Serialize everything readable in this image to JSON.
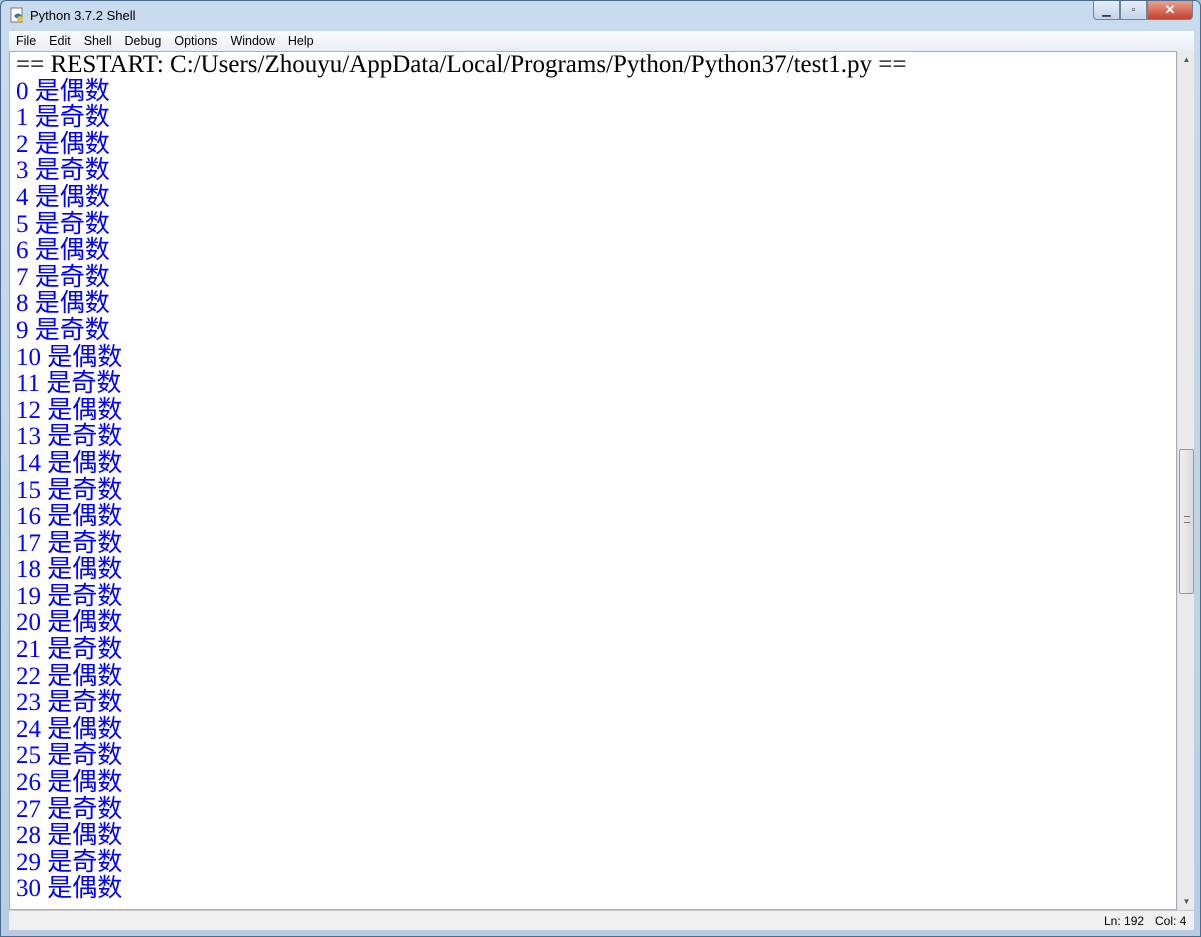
{
  "window": {
    "title": "Python 3.7.2 Shell",
    "icon": "python-idle-icon",
    "controls": [
      "minimize",
      "maximize",
      "close"
    ]
  },
  "menu": [
    "File",
    "Edit",
    "Shell",
    "Debug",
    "Options",
    "Window",
    "Help"
  ],
  "shell": {
    "restart_line": "== RESTART: C:/Users/Zhouyu/AppData/Local/Programs/Python/Python37/test1.py ==",
    "output_color": "#0000ff",
    "output": [
      "0 是偶数",
      "1 是奇数",
      "2 是偶数",
      "3 是奇数",
      "4 是偶数",
      "5 是奇数",
      "6 是偶数",
      "7 是奇数",
      "8 是偶数",
      "9 是奇数",
      "10 是偶数",
      "11 是奇数",
      "12 是偶数",
      "13 是奇数",
      "14 是偶数",
      "15 是奇数",
      "16 是偶数",
      "17 是奇数",
      "18 是偶数",
      "19 是奇数",
      "20 是偶数",
      "21 是奇数",
      "22 是偶数",
      "23 是奇数",
      "24 是偶数",
      "25 是奇数",
      "26 是偶数",
      "27 是奇数",
      "28 是偶数",
      "29 是奇数",
      "30 是偶数"
    ]
  },
  "status": {
    "line": "Ln: 192",
    "col": "Col: 4"
  }
}
